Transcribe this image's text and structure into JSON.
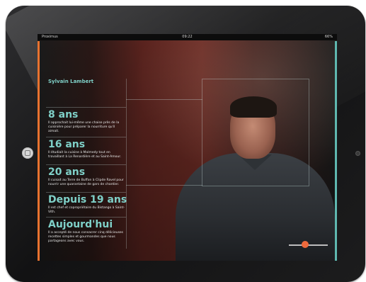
{
  "status": {
    "carrier": "Proximus",
    "time": "09:22",
    "battery": "66%"
  },
  "profile": {
    "name": "Sylvain Lambert"
  },
  "timeline": [
    {
      "year": "8 ans",
      "text": "Il approchait lui-même une chaise près de la cuisinière pour préparer la nourriture qu'il aimait."
    },
    {
      "year": "16 ans",
      "text": "Il étudiait la cuisine à Malmedy tout en travaillant à La Renardière et au Saint-Amour."
    },
    {
      "year": "20 ans",
      "text": "Il cuisait au Terre de Buffon à Clipde Ravel pour nourrir une quarantaine de gars de chantier."
    },
    {
      "year": "Depuis 19 ans",
      "text": "Il est chef et copropriétaire du Bistango à Saint-Vith."
    },
    {
      "year": "Aujourd'hui",
      "text": "Il a accepté de nous consacrer cinq délicieuses recettes simples et gourmandes que nous partageons avec vous."
    }
  ],
  "colors": {
    "accent_orange": "#e8722f",
    "accent_teal": "#7fd0c8",
    "slider_knob": "#ef6a3c"
  },
  "slider": {
    "position": 0.42
  }
}
